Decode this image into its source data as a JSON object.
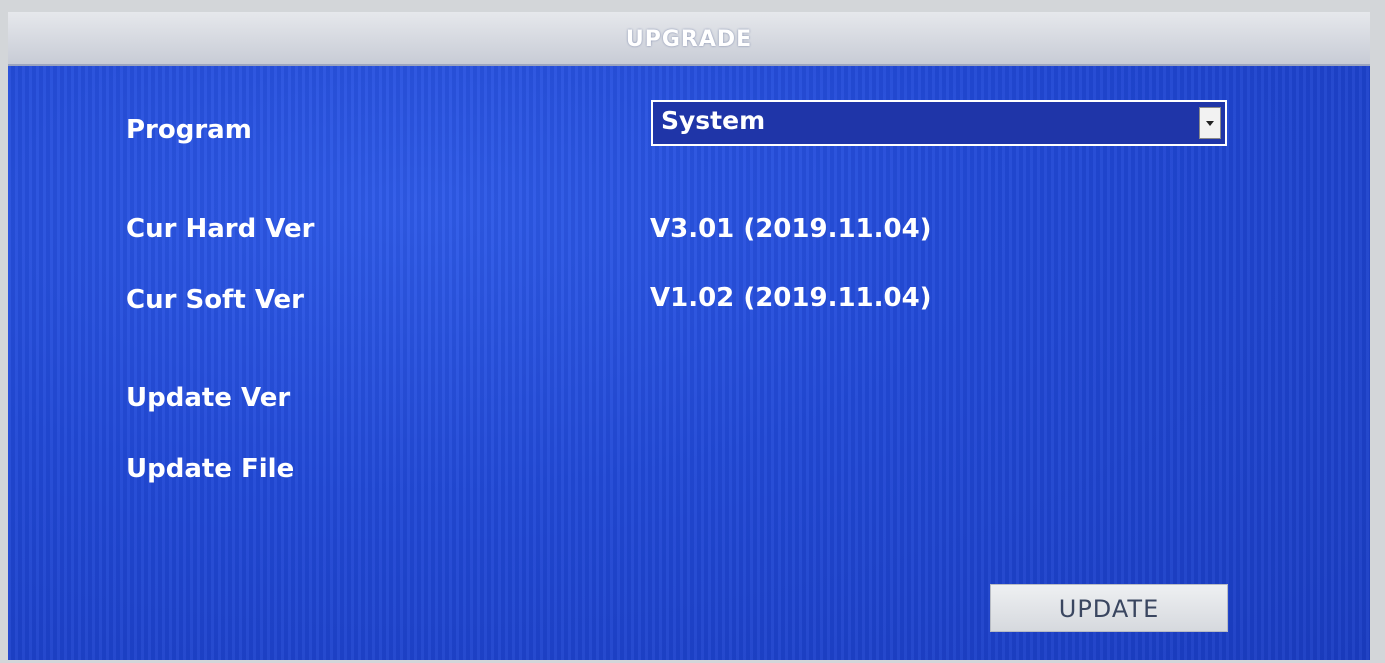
{
  "window": {
    "title": "UPGRADE"
  },
  "form": {
    "program_label": "Program",
    "program_value": "System",
    "cur_hard_ver_label": "Cur Hard Ver",
    "cur_hard_ver_value": "V3.01 (2019.11.04)",
    "cur_soft_ver_label": "Cur Soft Ver",
    "cur_soft_ver_value": "V1.02 (2019.11.04)",
    "update_ver_label": "Update Ver",
    "update_file_label": "Update File"
  },
  "actions": {
    "update_label": "UPDATE"
  },
  "icons": {
    "select_arrow": "chevron-down-icon"
  },
  "colors": {
    "background": "#2149d6",
    "titlebar": "#c8ccd6",
    "text": "#ffffff",
    "button": "#e2e5e9"
  }
}
